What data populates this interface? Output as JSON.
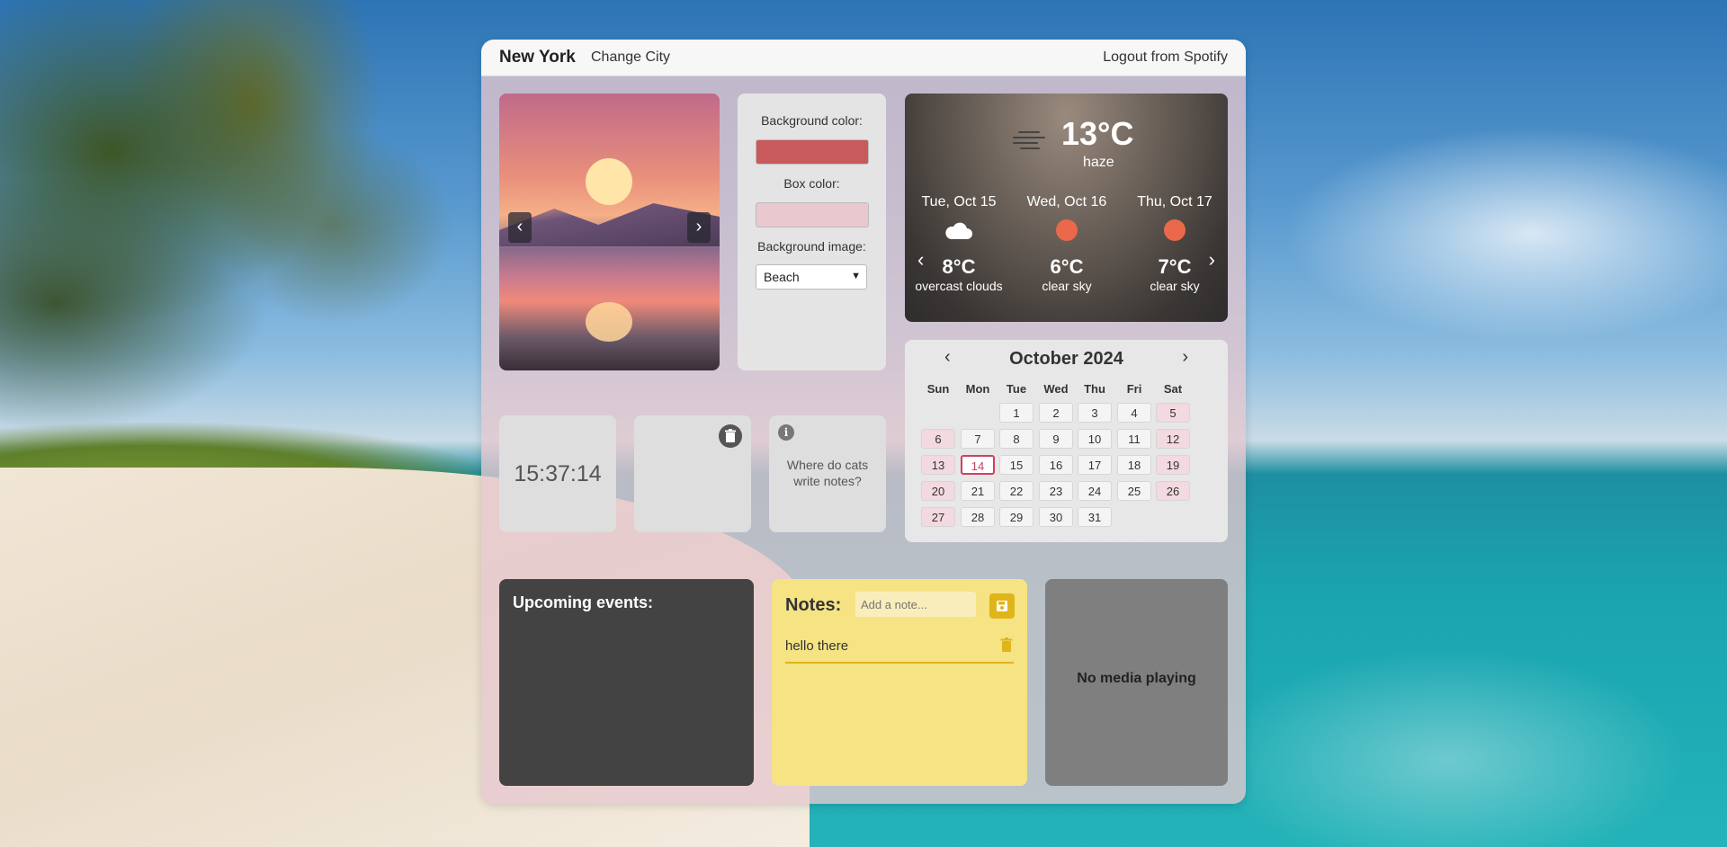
{
  "header": {
    "city": "New York",
    "change_city": "Change City",
    "logout": "Logout from Spotify"
  },
  "slideshow": {
    "prev": "‹",
    "next": "›"
  },
  "settings": {
    "bg_color_label": "Background color:",
    "bg_color_value": "#c95a5c",
    "box_color_label": "Box color:",
    "box_color_value": "#e9c9cf",
    "bg_image_label": "Background image:",
    "bg_image_selected": "Beach"
  },
  "weather": {
    "current_temp": "13°C",
    "current_condition": "haze",
    "forecast": [
      {
        "date": "Tue, Oct 15",
        "icon": "cloud-icon",
        "temp": "8°C",
        "desc": "overcast clouds"
      },
      {
        "date": "Wed, Oct 16",
        "icon": "sun-icon",
        "temp": "6°C",
        "desc": "clear sky"
      },
      {
        "date": "Thu, Oct 17",
        "icon": "sun-icon",
        "temp": "7°C",
        "desc": "clear sky"
      }
    ],
    "prev": "‹",
    "next": "›"
  },
  "calendar": {
    "title": "October 2024",
    "prev": "‹",
    "next": "›",
    "days_of_week": [
      "Sun",
      "Mon",
      "Tue",
      "Wed",
      "Thu",
      "Fri",
      "Sat"
    ],
    "first_weekday": 2,
    "days_in_month": 31,
    "today": 14
  },
  "clock": {
    "time": "15:37:14"
  },
  "fact": {
    "text": "Where do cats write notes?"
  },
  "events": {
    "title": "Upcoming events:"
  },
  "notes": {
    "title": "Notes:",
    "placeholder": "Add a note...",
    "items": [
      "hello there"
    ]
  },
  "media": {
    "status": "No media playing"
  },
  "colors": {
    "accent_yellow": "#e0b51a",
    "today_red": "#d04060",
    "weekend_pink": "#f3d9e0"
  }
}
